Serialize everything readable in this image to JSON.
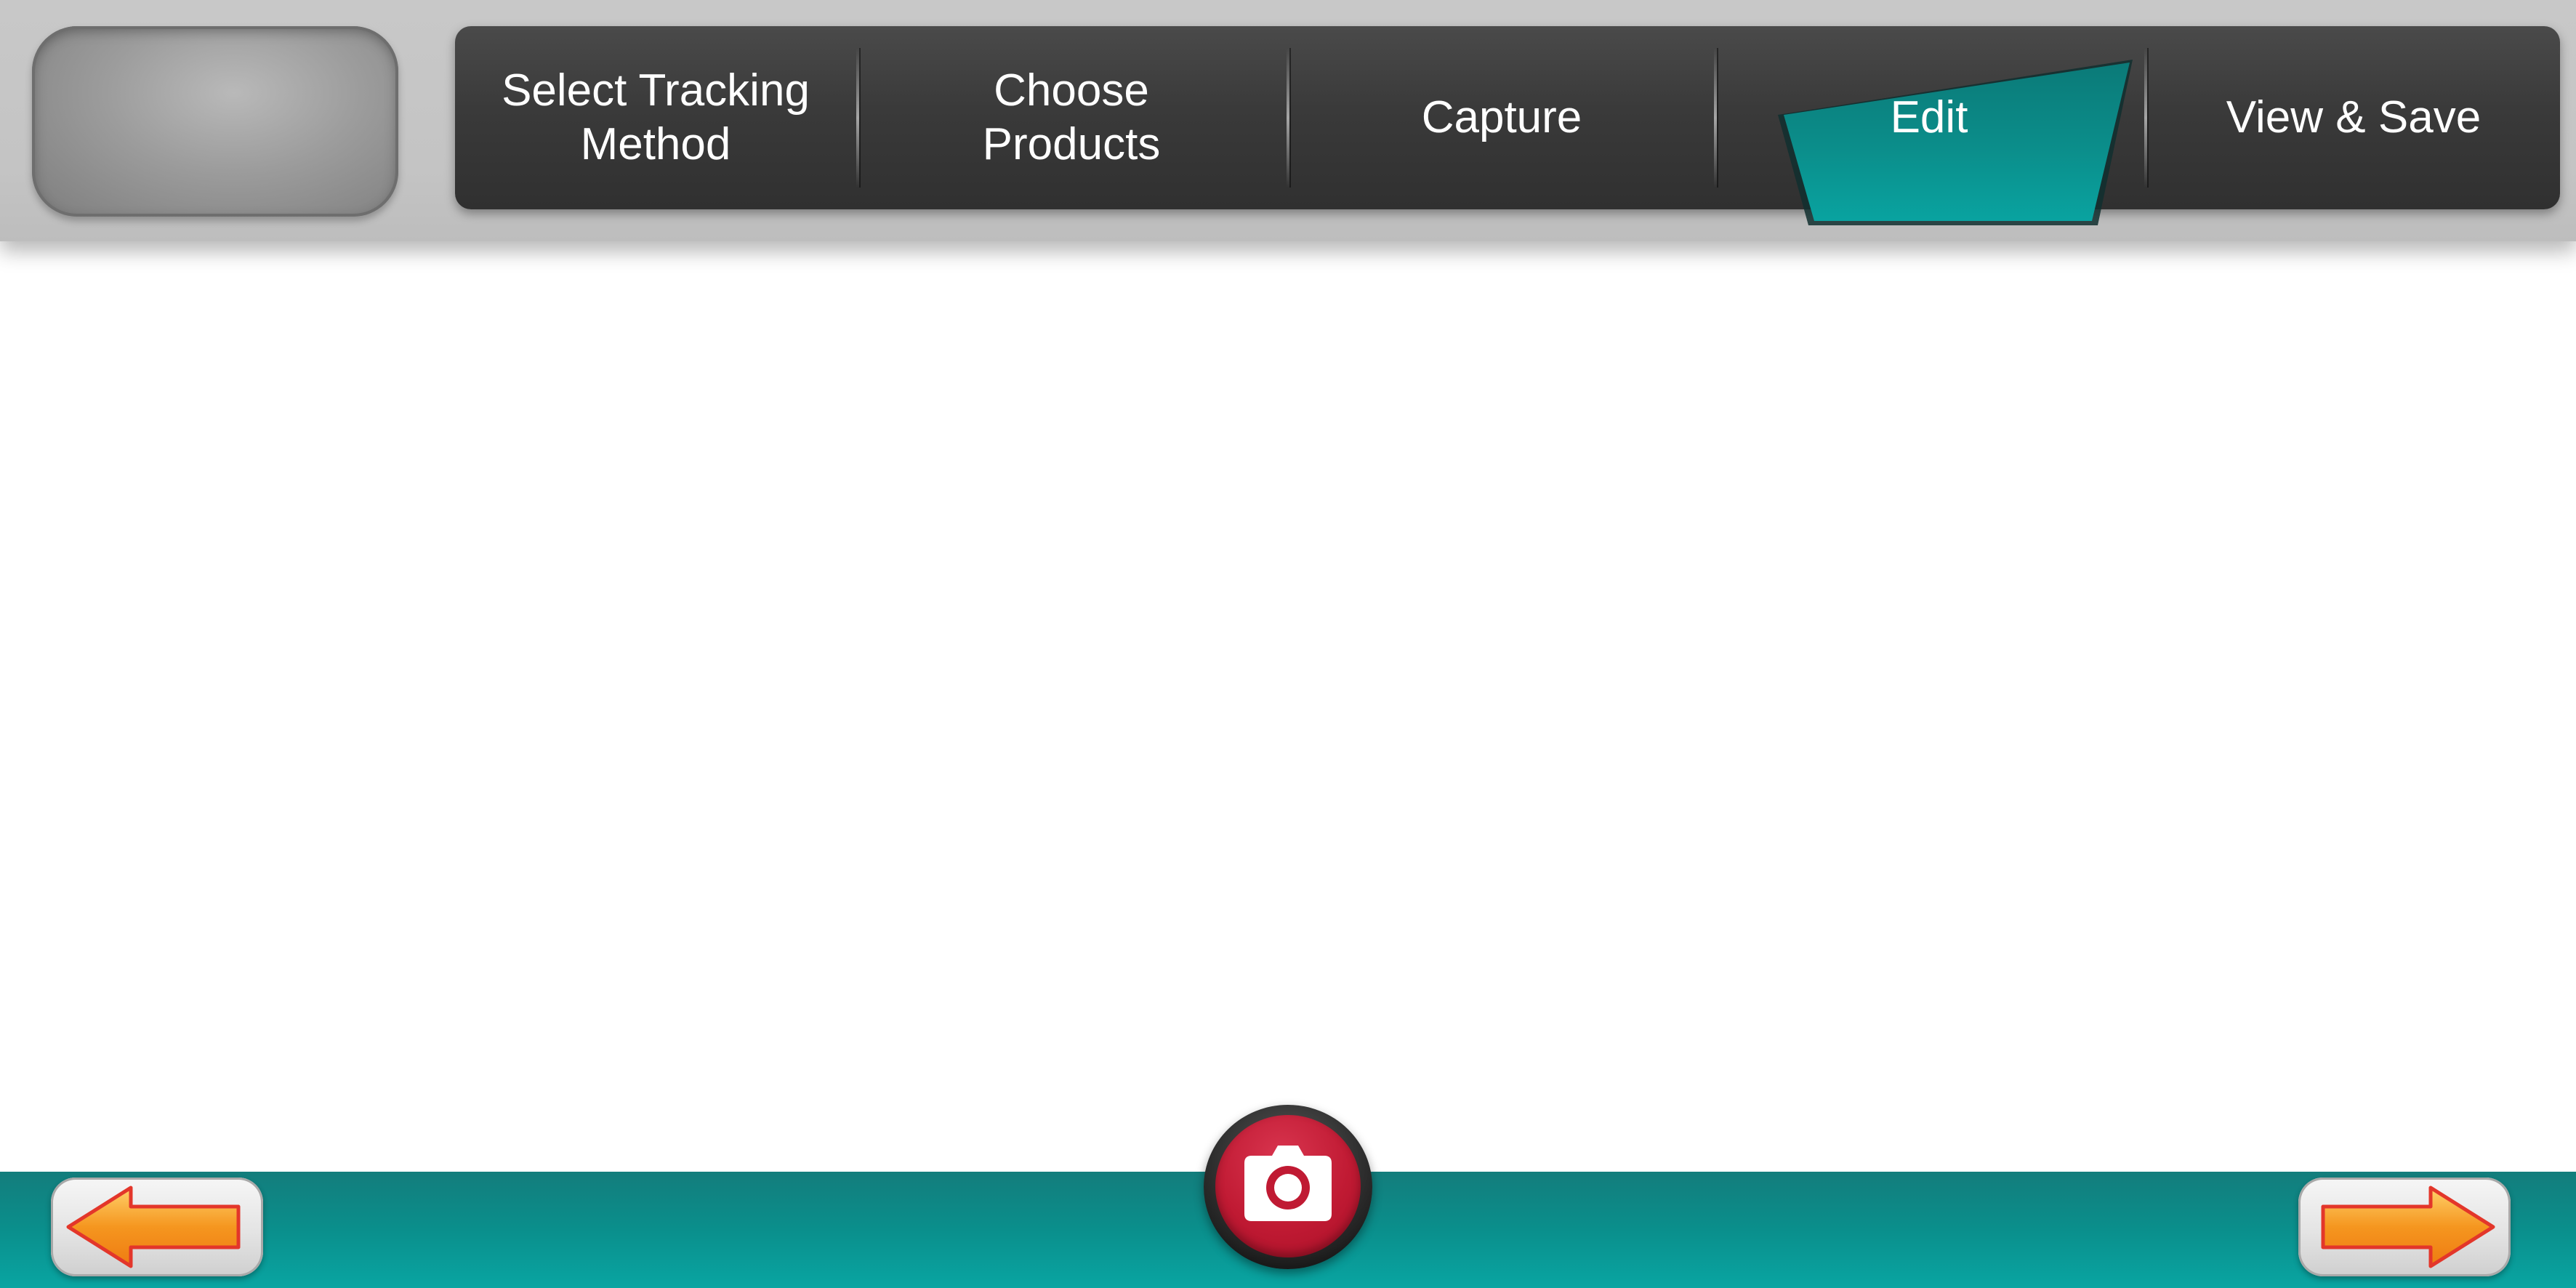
{
  "header": {
    "logo_slot": ""
  },
  "steps": [
    {
      "label": "Select Tracking\nMethod",
      "active": false
    },
    {
      "label": "Choose\nProducts",
      "active": false
    },
    {
      "label": "Capture",
      "active": true
    },
    {
      "label": "Edit",
      "active": false
    },
    {
      "label": "View & Save",
      "active": false
    }
  ],
  "footer": {
    "back_icon": "arrow-left-icon",
    "capture_icon": "camera-icon",
    "next_icon": "arrow-right-icon"
  },
  "colors": {
    "accent_teal": "#0a9a97",
    "stepbar_dark": "#333333",
    "capture_red": "#c01a33",
    "arrow_orange": "#f28a1a"
  }
}
